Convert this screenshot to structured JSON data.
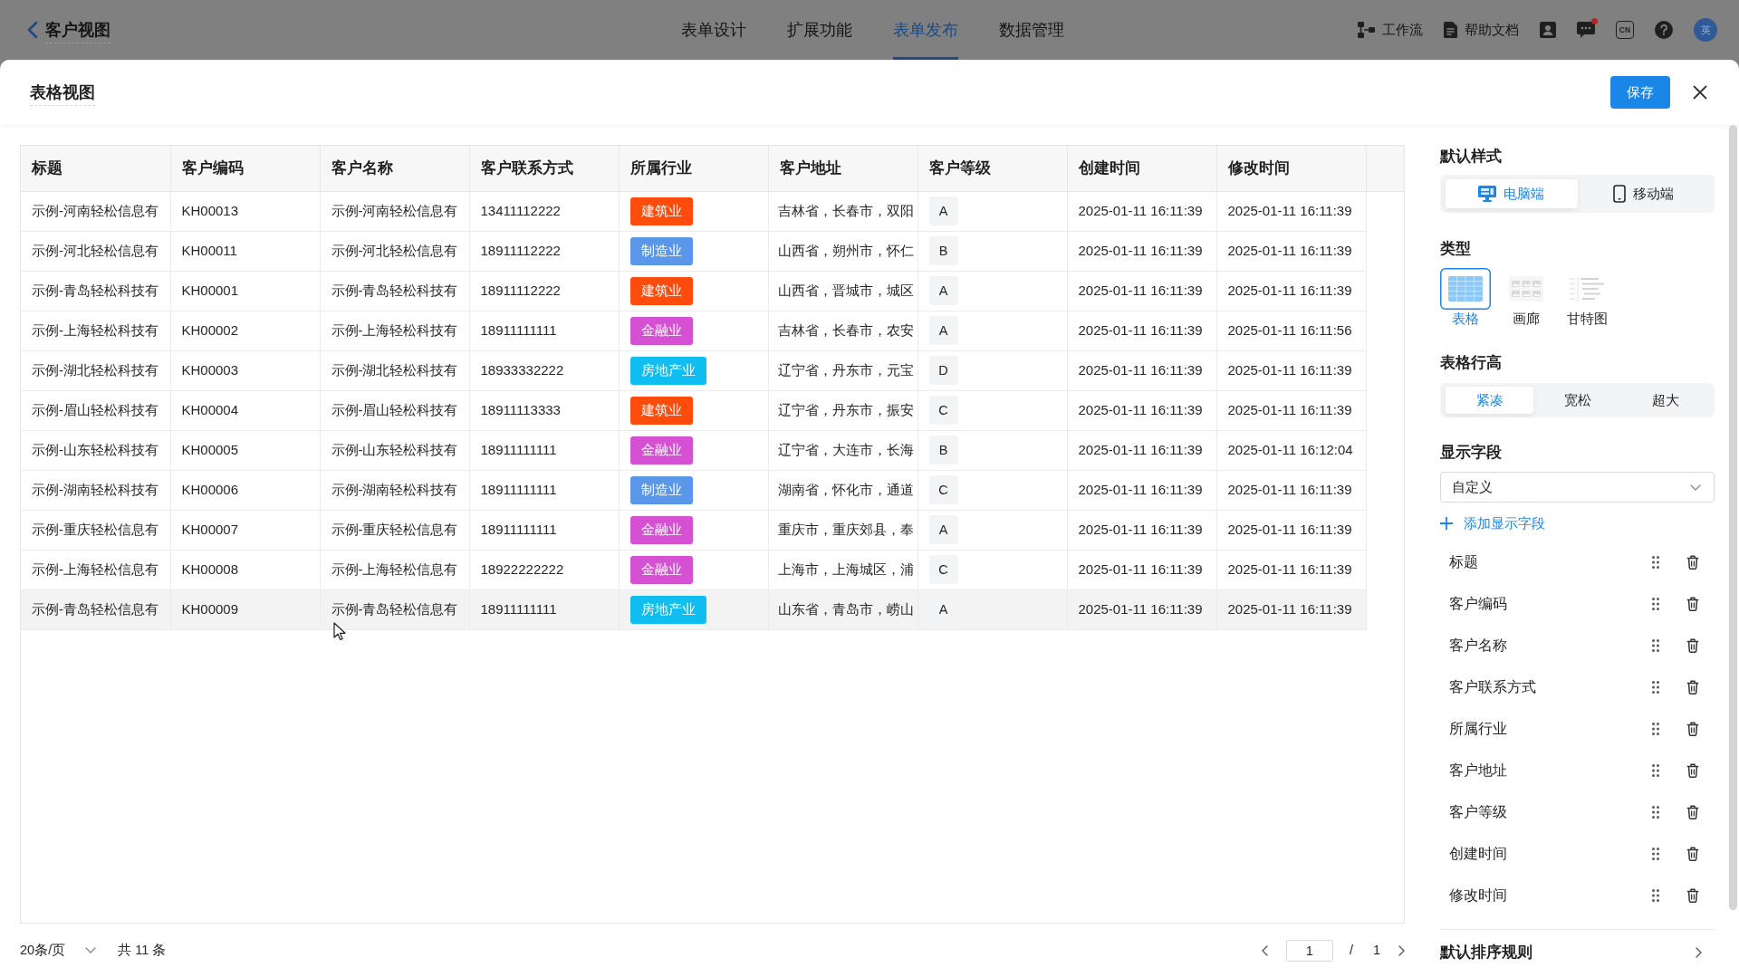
{
  "topbar": {
    "back_label": "客户视图",
    "tabs": [
      {
        "label": "表单设计",
        "selected": false
      },
      {
        "label": "扩展功能",
        "selected": false
      },
      {
        "label": "表单发布",
        "selected": true
      },
      {
        "label": "数据管理",
        "selected": false
      }
    ],
    "links": [
      {
        "kind": "workflow",
        "label": "工作流"
      },
      {
        "kind": "docs",
        "label": "帮助文档"
      }
    ],
    "chat_unread": true,
    "language": "CN",
    "avatar_text": "英"
  },
  "modal": {
    "title": "表格视图",
    "save_label": "保存"
  },
  "table": {
    "columns": [
      "标题",
      "客户编码",
      "客户名称",
      "客户联系方式",
      "所属行业",
      "客户地址",
      "客户等级",
      "创建时间",
      "修改时间"
    ],
    "rows": [
      {
        "title": "示例-河南轻松信息有",
        "code": "KH00013",
        "name": "示例-河南轻松信息有",
        "phone": "13411112222",
        "industry": {
          "label": "建筑业",
          "color": "#ff4b0c"
        },
        "address": "吉林省，长春市，双阳",
        "level": "A",
        "created": "2025-01-11 16:11:39",
        "modified": "2025-01-11 16:11:39",
        "highlighted": false
      },
      {
        "title": "示例-河北轻松信息有",
        "code": "KH00011",
        "name": "示例-河北轻松信息有",
        "phone": "18911112222",
        "industry": {
          "label": "制造业",
          "color": "#5b97e8"
        },
        "address": "山西省，朔州市，怀仁",
        "level": "B",
        "created": "2025-01-11 16:11:39",
        "modified": "2025-01-11 16:11:39",
        "highlighted": false
      },
      {
        "title": "示例-青岛轻松科技有",
        "code": "KH00001",
        "name": "示例-青岛轻松科技有",
        "phone": "18911112222",
        "industry": {
          "label": "建筑业",
          "color": "#ff4b0c"
        },
        "address": "山西省，晋城市，城区",
        "level": "A",
        "created": "2025-01-11 16:11:39",
        "modified": "2025-01-11 16:11:39",
        "highlighted": false
      },
      {
        "title": "示例-上海轻松科技有",
        "code": "KH00002",
        "name": "示例-上海轻松科技有",
        "phone": "18911111111",
        "industry": {
          "label": "金融业",
          "color": "#d550d3"
        },
        "address": "吉林省，长春市，农安",
        "level": "A",
        "created": "2025-01-11 16:11:39",
        "modified": "2025-01-11 16:11:56",
        "highlighted": false
      },
      {
        "title": "示例-湖北轻松科技有",
        "code": "KH00003",
        "name": "示例-湖北轻松科技有",
        "phone": "18933332222",
        "industry": {
          "label": "房地产业",
          "color": "#0fbdf0"
        },
        "address": "辽宁省，丹东市，元宝",
        "level": "D",
        "created": "2025-01-11 16:11:39",
        "modified": "2025-01-11 16:11:39",
        "highlighted": false
      },
      {
        "title": "示例-眉山轻松科技有",
        "code": "KH00004",
        "name": "示例-眉山轻松科技有",
        "phone": "18911113333",
        "industry": {
          "label": "建筑业",
          "color": "#ff4b0c"
        },
        "address": "辽宁省，丹东市，振安",
        "level": "C",
        "created": "2025-01-11 16:11:39",
        "modified": "2025-01-11 16:11:39",
        "highlighted": false
      },
      {
        "title": "示例-山东轻松科技有",
        "code": "KH00005",
        "name": "示例-山东轻松科技有",
        "phone": "18911111111",
        "industry": {
          "label": "金融业",
          "color": "#d550d3"
        },
        "address": "辽宁省，大连市，长海",
        "level": "B",
        "created": "2025-01-11 16:11:39",
        "modified": "2025-01-11 16:12:04",
        "highlighted": false
      },
      {
        "title": "示例-湖南轻松科技有",
        "code": "KH00006",
        "name": "示例-湖南轻松科技有",
        "phone": "18911111111",
        "industry": {
          "label": "制造业",
          "color": "#5b97e8"
        },
        "address": "湖南省，怀化市，通道",
        "level": "C",
        "created": "2025-01-11 16:11:39",
        "modified": "2025-01-11 16:11:39",
        "highlighted": false
      },
      {
        "title": "示例-重庆轻松信息有",
        "code": "KH00007",
        "name": "示例-重庆轻松信息有",
        "phone": "18911111111",
        "industry": {
          "label": "金融业",
          "color": "#d550d3"
        },
        "address": "重庆市，重庆郊县，奉",
        "level": "A",
        "created": "2025-01-11 16:11:39",
        "modified": "2025-01-11 16:11:39",
        "highlighted": false
      },
      {
        "title": "示例-上海轻松信息有",
        "code": "KH00008",
        "name": "示例-上海轻松信息有",
        "phone": "18922222222",
        "industry": {
          "label": "金融业",
          "color": "#d550d3"
        },
        "address": "上海市，上海城区，浦",
        "level": "C",
        "created": "2025-01-11 16:11:39",
        "modified": "2025-01-11 16:11:39",
        "highlighted": false
      },
      {
        "title": "示例-青岛轻松信息有",
        "code": "KH00009",
        "name": "示例-青岛轻松信息有",
        "phone": "18911111111",
        "industry": {
          "label": "房地产业",
          "color": "#0fbdf0"
        },
        "address": "山东省，青岛市，崂山",
        "level": "A",
        "created": "2025-01-11 16:11:39",
        "modified": "2025-01-11 16:11:39",
        "highlighted": true
      }
    ]
  },
  "pagination": {
    "page_size": "20条/页",
    "total": "共 11 条",
    "page": "1",
    "separator": "/",
    "pages": "1"
  },
  "settings": {
    "style_heading": "默认样式",
    "devices": [
      {
        "kind": "desktop",
        "label": "电脑端",
        "selected": true
      },
      {
        "kind": "mobile",
        "label": "移动端",
        "selected": false
      }
    ],
    "type_heading": "类型",
    "types": [
      {
        "kind": "table",
        "label": "表格",
        "selected": true
      },
      {
        "kind": "gallery",
        "label": "画廊",
        "selected": false
      },
      {
        "kind": "gantt",
        "label": "甘特图",
        "selected": false
      }
    ],
    "row_height_heading": "表格行高",
    "row_heights": [
      {
        "label": "紧凑",
        "selected": true
      },
      {
        "label": "宽松",
        "selected": false
      },
      {
        "label": "超大",
        "selected": false
      }
    ],
    "fields_heading": "显示字段",
    "fields_mode": "自定义",
    "add_field": "添加显示字段",
    "fields": [
      "标题",
      "客户编码",
      "客户名称",
      "客户联系方式",
      "所属行业",
      "客户地址",
      "客户等级",
      "创建时间",
      "修改时间"
    ],
    "sort_heading": "默认排序规则"
  }
}
